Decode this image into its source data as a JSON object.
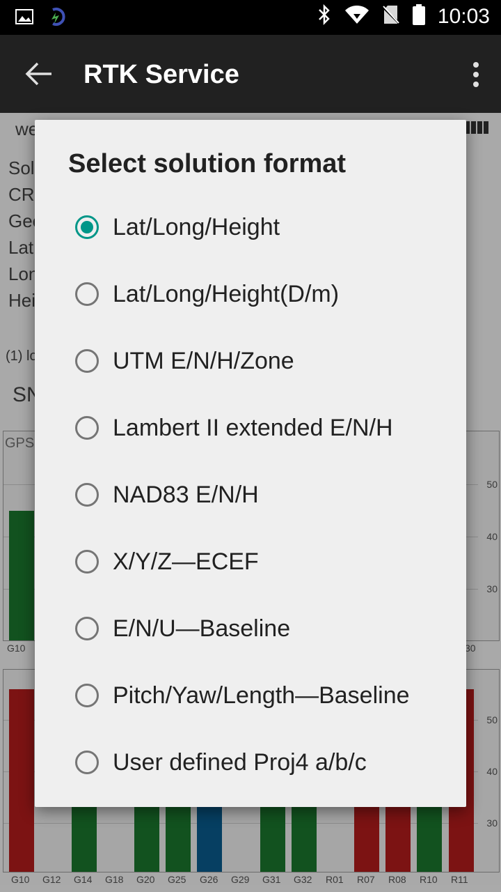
{
  "status_bar": {
    "time": "10:03",
    "icons": [
      "image-icon",
      "app-icon",
      "bluetooth-icon",
      "wifi-icon",
      "no-sim-icon",
      "battery-icon"
    ]
  },
  "toolbar": {
    "title": "RTK Service",
    "icons": [
      "back-arrow-icon",
      "overflow-menu-icon"
    ]
  },
  "background": {
    "partial_lines": [
      "we",
      "Sol",
      "CRS",
      "Gee",
      "Lat",
      "Lon",
      "Hei",
      "(1) lo",
      "SN"
    ],
    "chart1": {
      "label": "GPS",
      "x_first": "G10",
      "x_last": "30",
      "y_ticks": [
        "50",
        "40",
        "30"
      ]
    },
    "chart2": {
      "y_ticks": [
        "50",
        "40",
        "30"
      ],
      "x_labels": [
        "G10",
        "G12",
        "G14",
        "G18",
        "G20",
        "G25",
        "G26",
        "G29",
        "G31",
        "G32",
        "R01",
        "R07",
        "R08",
        "R10",
        "R11"
      ]
    },
    "colors": {
      "red": "#b71c1c",
      "green": "#1b7a2e",
      "blue": "#0a5d91"
    }
  },
  "dialog": {
    "title": "Select solution format",
    "selected_index": 0,
    "options": [
      {
        "label": "Lat/Long/Height"
      },
      {
        "label": "Lat/Long/Height(D/m)"
      },
      {
        "label": "UTM E/N/H/Zone"
      },
      {
        "label": "Lambert II extended E/N/H"
      },
      {
        "label": "NAD83 E/N/H"
      },
      {
        "label": "X/Y/Z—ECEF"
      },
      {
        "label": "E/N/U—Baseline"
      },
      {
        "label": "Pitch/Yaw/Length—Baseline"
      },
      {
        "label": "User defined Proj4 a/b/c"
      }
    ],
    "accent": "#009688"
  }
}
